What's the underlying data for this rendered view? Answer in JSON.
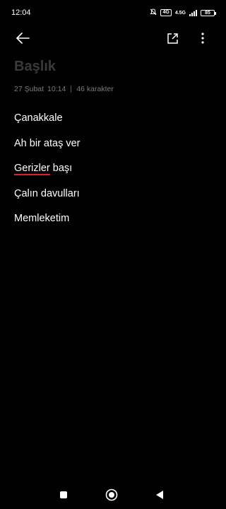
{
  "status_bar": {
    "time": "12:04",
    "volte_badge": "4G",
    "network_label": "4.5G",
    "battery_level": "85",
    "icons": [
      "mute-bell-icon",
      "volte-icon",
      "signal-icon",
      "battery-icon"
    ]
  },
  "toolbar": {
    "icons": [
      "back-arrow-icon",
      "share-icon",
      "more-options-icon"
    ]
  },
  "note": {
    "title_placeholder": "Başlık",
    "date": "27 Şubat",
    "time": "10:14",
    "char_count": "46 karakter",
    "lines": [
      {
        "text": "Çanakkale"
      },
      {
        "text": "Ah bir ataş ver"
      },
      {
        "misspelled": "Gerizler",
        "rest": " başı"
      },
      {
        "text": "Çalın davulları"
      },
      {
        "text": "Memleketim"
      }
    ]
  },
  "nav_bar": {
    "icons": [
      "recents-square-icon",
      "home-circle-icon",
      "back-triangle-icon"
    ]
  },
  "colors": {
    "background": "#000000",
    "text": "#ffffff",
    "placeholder": "#3a3a3a",
    "meta": "#7c7c7c",
    "spell_underline": "#d9232e"
  }
}
